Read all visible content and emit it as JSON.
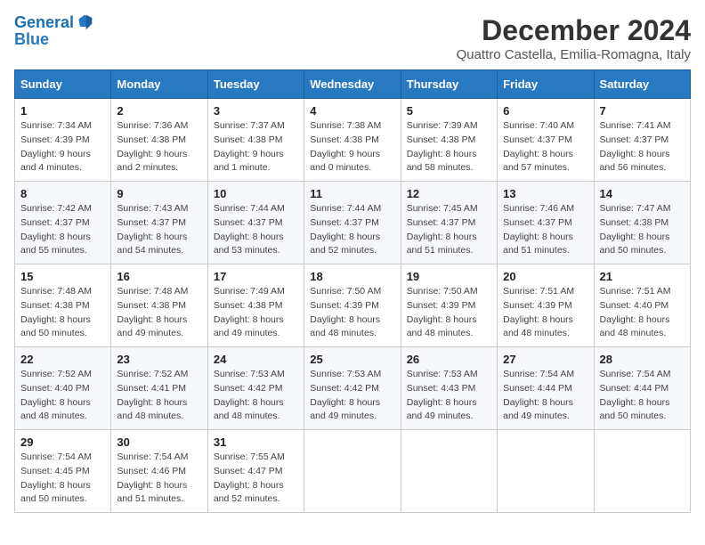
{
  "header": {
    "logo_line1": "General",
    "logo_line2": "Blue",
    "month_title": "December 2024",
    "subtitle": "Quattro Castella, Emilia-Romagna, Italy"
  },
  "days_of_week": [
    "Sunday",
    "Monday",
    "Tuesday",
    "Wednesday",
    "Thursday",
    "Friday",
    "Saturday"
  ],
  "weeks": [
    [
      {
        "day": "1",
        "sunrise": "7:34 AM",
        "sunset": "4:39 PM",
        "daylight": "9 hours and 4 minutes."
      },
      {
        "day": "2",
        "sunrise": "7:36 AM",
        "sunset": "4:38 PM",
        "daylight": "9 hours and 2 minutes."
      },
      {
        "day": "3",
        "sunrise": "7:37 AM",
        "sunset": "4:38 PM",
        "daylight": "9 hours and 1 minute."
      },
      {
        "day": "4",
        "sunrise": "7:38 AM",
        "sunset": "4:38 PM",
        "daylight": "9 hours and 0 minutes."
      },
      {
        "day": "5",
        "sunrise": "7:39 AM",
        "sunset": "4:38 PM",
        "daylight": "8 hours and 58 minutes."
      },
      {
        "day": "6",
        "sunrise": "7:40 AM",
        "sunset": "4:37 PM",
        "daylight": "8 hours and 57 minutes."
      },
      {
        "day": "7",
        "sunrise": "7:41 AM",
        "sunset": "4:37 PM",
        "daylight": "8 hours and 56 minutes."
      }
    ],
    [
      {
        "day": "8",
        "sunrise": "7:42 AM",
        "sunset": "4:37 PM",
        "daylight": "8 hours and 55 minutes."
      },
      {
        "day": "9",
        "sunrise": "7:43 AM",
        "sunset": "4:37 PM",
        "daylight": "8 hours and 54 minutes."
      },
      {
        "day": "10",
        "sunrise": "7:44 AM",
        "sunset": "4:37 PM",
        "daylight": "8 hours and 53 minutes."
      },
      {
        "day": "11",
        "sunrise": "7:44 AM",
        "sunset": "4:37 PM",
        "daylight": "8 hours and 52 minutes."
      },
      {
        "day": "12",
        "sunrise": "7:45 AM",
        "sunset": "4:37 PM",
        "daylight": "8 hours and 51 minutes."
      },
      {
        "day": "13",
        "sunrise": "7:46 AM",
        "sunset": "4:37 PM",
        "daylight": "8 hours and 51 minutes."
      },
      {
        "day": "14",
        "sunrise": "7:47 AM",
        "sunset": "4:38 PM",
        "daylight": "8 hours and 50 minutes."
      }
    ],
    [
      {
        "day": "15",
        "sunrise": "7:48 AM",
        "sunset": "4:38 PM",
        "daylight": "8 hours and 50 minutes."
      },
      {
        "day": "16",
        "sunrise": "7:48 AM",
        "sunset": "4:38 PM",
        "daylight": "8 hours and 49 minutes."
      },
      {
        "day": "17",
        "sunrise": "7:49 AM",
        "sunset": "4:38 PM",
        "daylight": "8 hours and 49 minutes."
      },
      {
        "day": "18",
        "sunrise": "7:50 AM",
        "sunset": "4:39 PM",
        "daylight": "8 hours and 48 minutes."
      },
      {
        "day": "19",
        "sunrise": "7:50 AM",
        "sunset": "4:39 PM",
        "daylight": "8 hours and 48 minutes."
      },
      {
        "day": "20",
        "sunrise": "7:51 AM",
        "sunset": "4:39 PM",
        "daylight": "8 hours and 48 minutes."
      },
      {
        "day": "21",
        "sunrise": "7:51 AM",
        "sunset": "4:40 PM",
        "daylight": "8 hours and 48 minutes."
      }
    ],
    [
      {
        "day": "22",
        "sunrise": "7:52 AM",
        "sunset": "4:40 PM",
        "daylight": "8 hours and 48 minutes."
      },
      {
        "day": "23",
        "sunrise": "7:52 AM",
        "sunset": "4:41 PM",
        "daylight": "8 hours and 48 minutes."
      },
      {
        "day": "24",
        "sunrise": "7:53 AM",
        "sunset": "4:42 PM",
        "daylight": "8 hours and 48 minutes."
      },
      {
        "day": "25",
        "sunrise": "7:53 AM",
        "sunset": "4:42 PM",
        "daylight": "8 hours and 49 minutes."
      },
      {
        "day": "26",
        "sunrise": "7:53 AM",
        "sunset": "4:43 PM",
        "daylight": "8 hours and 49 minutes."
      },
      {
        "day": "27",
        "sunrise": "7:54 AM",
        "sunset": "4:44 PM",
        "daylight": "8 hours and 49 minutes."
      },
      {
        "day": "28",
        "sunrise": "7:54 AM",
        "sunset": "4:44 PM",
        "daylight": "8 hours and 50 minutes."
      }
    ],
    [
      {
        "day": "29",
        "sunrise": "7:54 AM",
        "sunset": "4:45 PM",
        "daylight": "8 hours and 50 minutes."
      },
      {
        "day": "30",
        "sunrise": "7:54 AM",
        "sunset": "4:46 PM",
        "daylight": "8 hours and 51 minutes."
      },
      {
        "day": "31",
        "sunrise": "7:55 AM",
        "sunset": "4:47 PM",
        "daylight": "8 hours and 52 minutes."
      },
      null,
      null,
      null,
      null
    ]
  ]
}
